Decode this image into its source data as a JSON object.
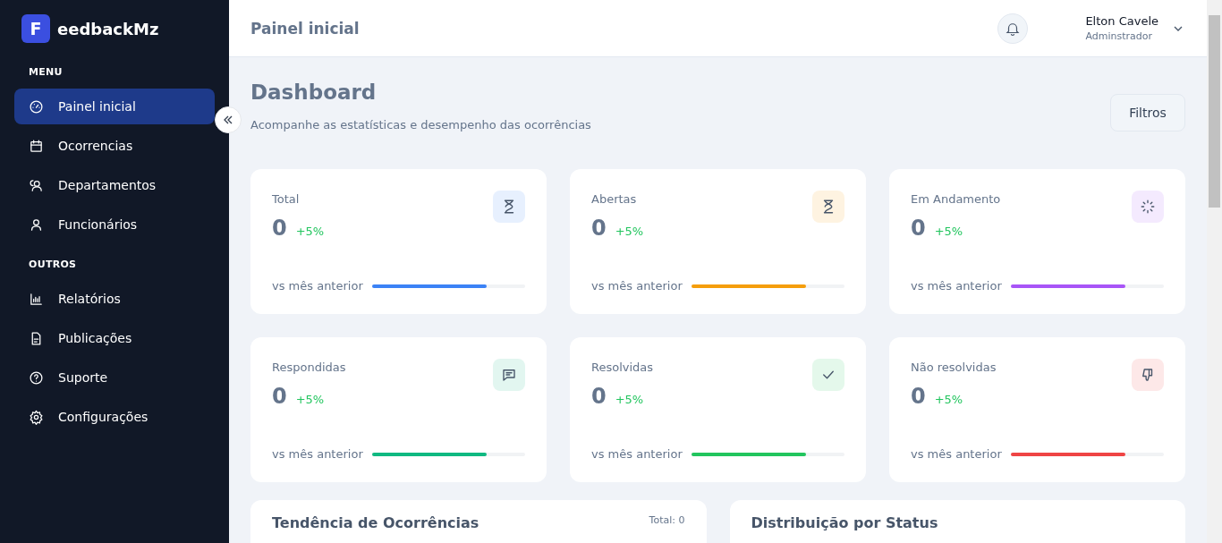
{
  "brand": {
    "letter": "F",
    "name": "eedbackMz"
  },
  "sidebar": {
    "sections": [
      {
        "title": "MENU",
        "items": [
          {
            "label": "Painel inicial",
            "selected": true
          },
          {
            "label": "Ocorrencias",
            "selected": false
          },
          {
            "label": "Departamentos",
            "selected": false
          },
          {
            "label": "Funcionários",
            "selected": false
          }
        ]
      },
      {
        "title": "OUTROS",
        "items": [
          {
            "label": "Relatórios",
            "selected": false
          },
          {
            "label": "Publicações",
            "selected": false
          },
          {
            "label": "Suporte",
            "selected": false
          },
          {
            "label": "Configurações",
            "selected": false
          }
        ]
      }
    ]
  },
  "header": {
    "title": "Painel inicial",
    "user_name": "Elton Cavele",
    "user_role": "Adminstrador"
  },
  "page": {
    "title": "Dashboard",
    "subtitle": "Acompanhe as estatísticas e desempenho das ocorrências",
    "filter_button": "Filtros"
  },
  "stats": [
    {
      "label": "Total",
      "value": "0",
      "change": "+5%",
      "caption": "vs mês anterior",
      "level": 0.75,
      "color": "#3b82f6"
    },
    {
      "label": "Abertas",
      "value": "0",
      "change": "+5%",
      "caption": "vs mês anterior",
      "level": 0.75,
      "color": "#f59e0b"
    },
    {
      "label": "Em Andamento",
      "value": "0",
      "change": "+5%",
      "caption": "vs mês anterior",
      "level": 0.75,
      "color": "#a855f7"
    },
    {
      "label": "Respondidas",
      "value": "0",
      "change": "+5%",
      "caption": "vs mês anterior",
      "level": 0.75,
      "color": "#10b981"
    },
    {
      "label": "Resolvidas",
      "value": "0",
      "change": "+5%",
      "caption": "vs mês anterior",
      "level": 0.75,
      "color": "#22c55e"
    },
    {
      "label": "Não resolvidas",
      "value": "0",
      "change": "+5%",
      "caption": "vs mês anterior",
      "level": 0.75,
      "color": "#ef4444"
    }
  ],
  "panels": [
    {
      "title": "Tendência de Ocorrências",
      "aside": "Total: 0"
    },
    {
      "title": "Distribuição por Status"
    }
  ]
}
